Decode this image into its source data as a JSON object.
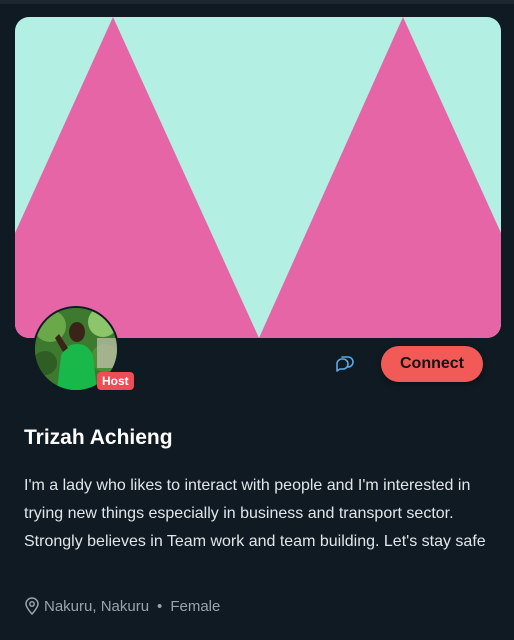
{
  "profile": {
    "name": "Trizah Achieng",
    "badge": "Host",
    "bio": "I'm a lady who likes to interact with people and I'm interested in trying new things especially in business and transport sector. Strongly believes in Team work and team building. Let's stay safe",
    "location": "Nakuru, Nakuru",
    "separator": "•",
    "gender": "Female"
  },
  "actions": {
    "connect_label": "Connect"
  },
  "icons": {
    "chat": "chat-bubbles-icon",
    "location": "map-pin-icon"
  },
  "colors": {
    "background": "#0f1a22",
    "banner_mint": "#b4efe4",
    "banner_pink": "#e565a6",
    "accent": "#f25a57",
    "badge": "#ef4d55"
  }
}
